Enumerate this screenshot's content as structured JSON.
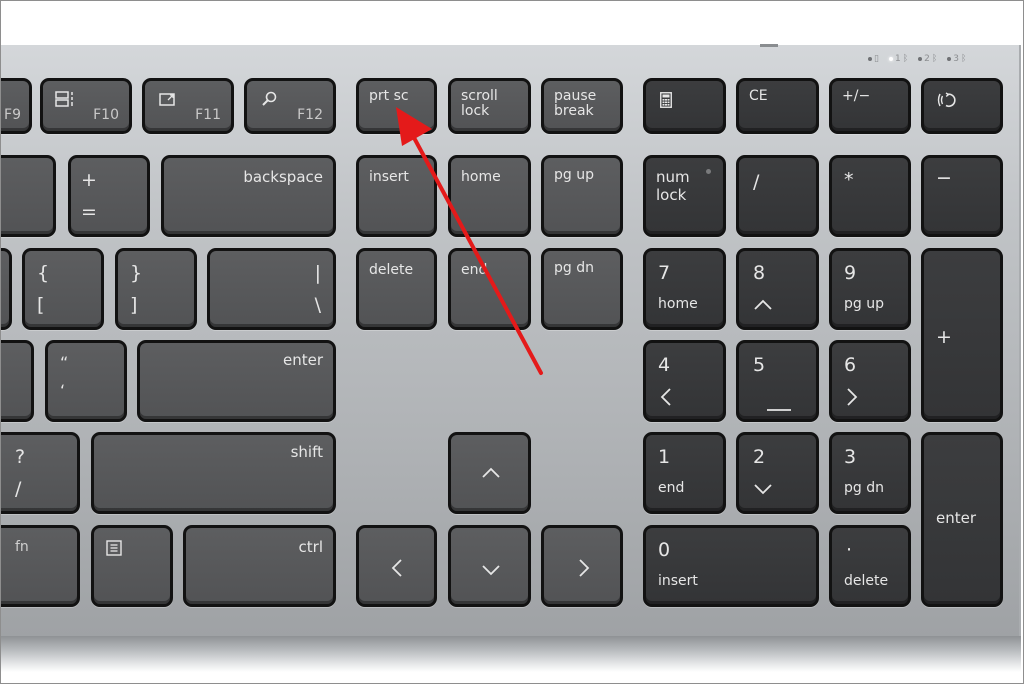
{
  "annotation": {
    "type": "arrow",
    "color": "#e41a1a",
    "target": "prt sc"
  },
  "status_leds": [
    {
      "label": "• caps",
      "glyph": "▯",
      "on": false
    },
    {
      "label": "1",
      "glyph": "1",
      "on": true
    },
    {
      "label": "2",
      "glyph": "2",
      "on": false
    },
    {
      "label": "3",
      "glyph": "3",
      "on": false
    }
  ],
  "function_row": {
    "f9": "F9",
    "f10": "F10",
    "f11": "F11",
    "f12": "F12",
    "prtsc": "prt sc",
    "scroll_lock": "scroll\nlock",
    "pause_break": "pause\nbreak",
    "ce": "CE",
    "plus_minus": "+/−"
  },
  "number_row": {
    "plus": "+",
    "equals": "=",
    "backspace": "backspace"
  },
  "top_row": {
    "lbrace": "{",
    "lbracket": "[",
    "rbrace": "}",
    "rbracket": "]",
    "pipe": "|",
    "backslash": "\\"
  },
  "home_row": {
    "dquote": "“",
    "squote": "‘",
    "enter": "enter"
  },
  "shift_row": {
    "question": "?",
    "slash": "/",
    "shift": "shift"
  },
  "bottom_row": {
    "fn": "fn",
    "ctrl": "ctrl"
  },
  "nav_cluster": {
    "insert": "insert",
    "home": "home",
    "pg_up": "pg up",
    "delete": "delete",
    "end": "end",
    "pg_dn": "pg dn"
  },
  "arrows": {
    "up": "^",
    "left": "<",
    "down": "v",
    "right": ">"
  },
  "numpad": {
    "num_lock": "num\nlock",
    "divide": "/",
    "multiply": "*",
    "minus": "−",
    "plus": "+",
    "enter": "enter",
    "k7": "7",
    "k7_sub": "home",
    "k8": "8",
    "k9": "9",
    "k9_sub": "pg up",
    "k4": "4",
    "k5": "5",
    "k6": "6",
    "k1": "1",
    "k1_sub": "end",
    "k2": "2",
    "k3": "3",
    "k3_sub": "pg dn",
    "k0": "0",
    "k0_sub": "insert",
    "dot": "·",
    "dot_sub": "delete"
  }
}
